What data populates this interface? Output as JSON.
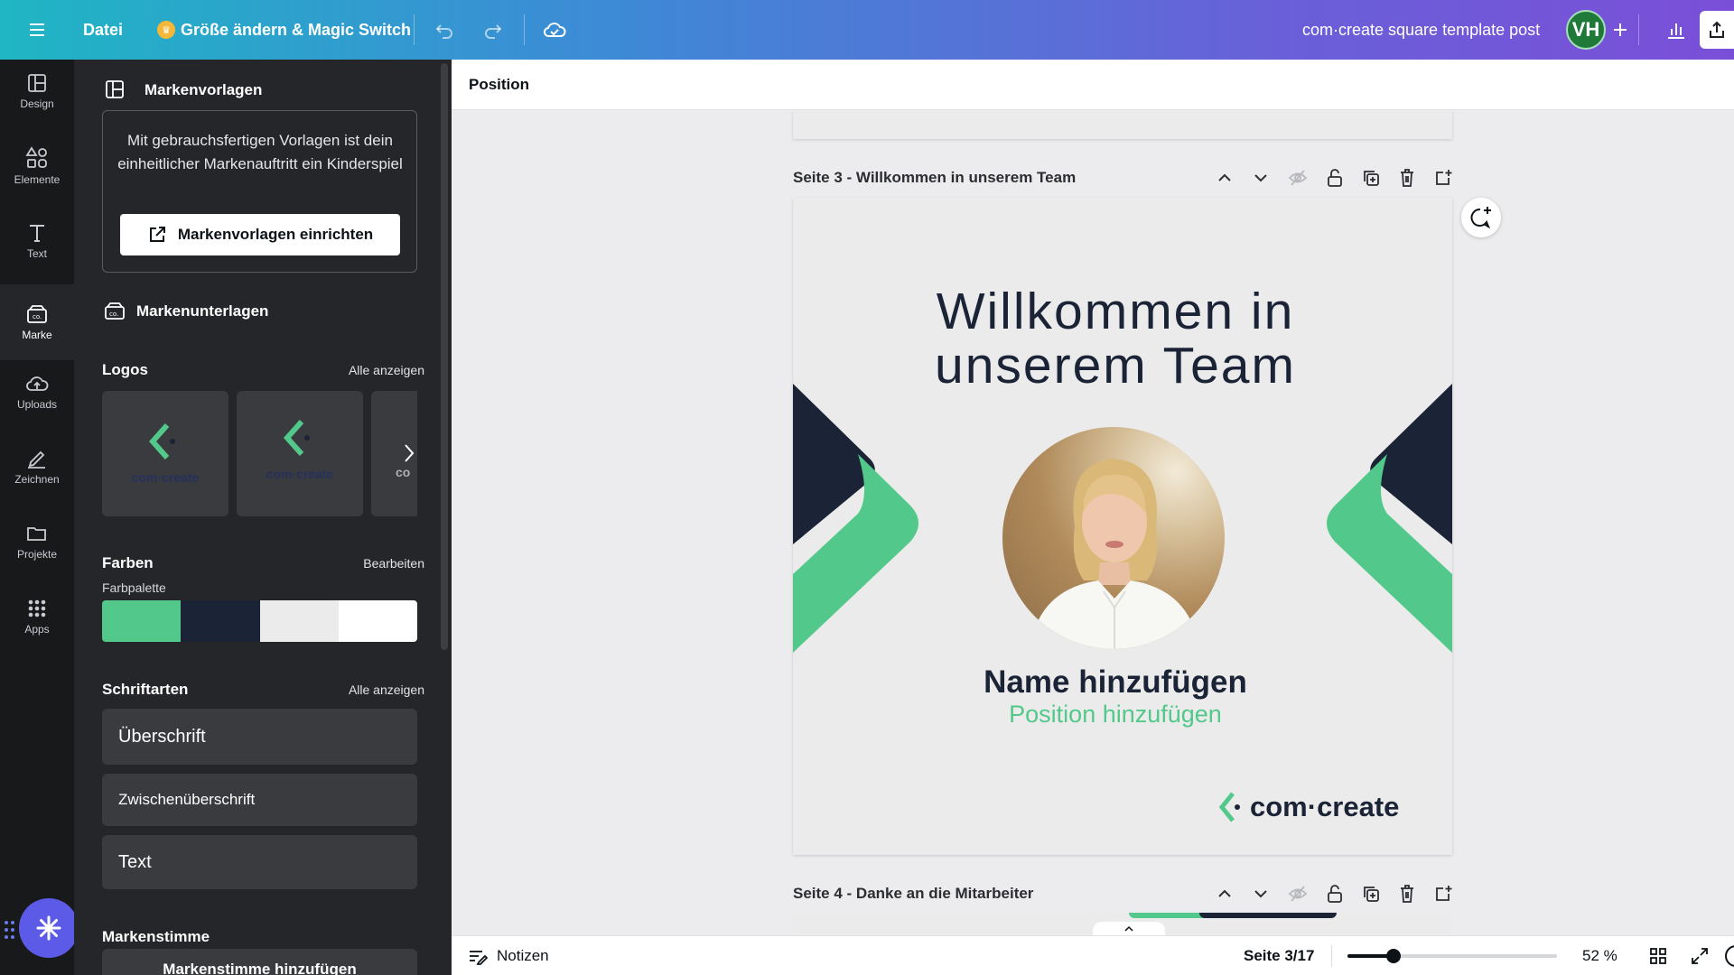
{
  "topbar": {
    "menu_icon": "hamburger-icon",
    "file_label": "Datei",
    "resize_label": "Größe ändern & Magic Switch",
    "doc_title": "com·create square template post",
    "avatar_initials": "VH",
    "colors": {
      "gradient_start": "#1fb6c4",
      "gradient_end": "#7a4fd8",
      "avatar_bg": "#1f7a3a"
    }
  },
  "rail": {
    "items": [
      {
        "label": "Design",
        "icon": "layout-icon"
      },
      {
        "label": "Elemente",
        "icon": "shapes-icon"
      },
      {
        "label": "Text",
        "icon": "text-icon"
      },
      {
        "label": "Marke",
        "icon": "brand-icon",
        "active": true
      },
      {
        "label": "Uploads",
        "icon": "cloud-upload-icon"
      },
      {
        "label": "Zeichnen",
        "icon": "pen-icon"
      },
      {
        "label": "Projekte",
        "icon": "folder-icon"
      },
      {
        "label": "Apps",
        "icon": "apps-grid-icon"
      }
    ]
  },
  "panel": {
    "templates_title": "Markenvorlagen",
    "templates_desc": "Mit gebrauchsfertigen Vorlagen ist dein einheitlicher Markenauftritt ein Kinderspiel",
    "templates_button": "Markenvorlagen einrichten",
    "kit_title": "Markenunterlagen",
    "logos_title": "Logos",
    "logos_link": "Alle anzeigen",
    "logo_texts": [
      "com·create",
      "com·create",
      "co"
    ],
    "colors_title": "Farben",
    "colors_link": "Bearbeiten",
    "palette_label": "Farbpalette",
    "palette": [
      "#52c98a",
      "#1b2436",
      "#ebebeb",
      "#ffffff"
    ],
    "fonts_title": "Schriftarten",
    "fonts_link": "Alle anzeigen",
    "font_items": [
      "Überschrift",
      "Zwischenüberschrift",
      "Text"
    ],
    "voice_title": "Markenstimme",
    "voice_button": "Markenstimme hinzufügen"
  },
  "editbar": {
    "position_label": "Position"
  },
  "pages": {
    "page3_title": "Seite 3 - Willkommen in unserem Team",
    "page4_title": "Seite 4 - Danke an die Mitarbeiter"
  },
  "design": {
    "headline_line1": "Willkommen in",
    "headline_line2": "unserem Team",
    "name": "Name hinzufügen",
    "position": "Position hinzufügen",
    "brand": "com·create",
    "colors": {
      "green": "#52c98a",
      "navy": "#1b2436",
      "bg": "#ebebeb"
    }
  },
  "footer": {
    "notes_label": "Notizen",
    "page_counter": "Seite 3/17",
    "zoom_value": 52,
    "zoom_label": "52 %"
  }
}
